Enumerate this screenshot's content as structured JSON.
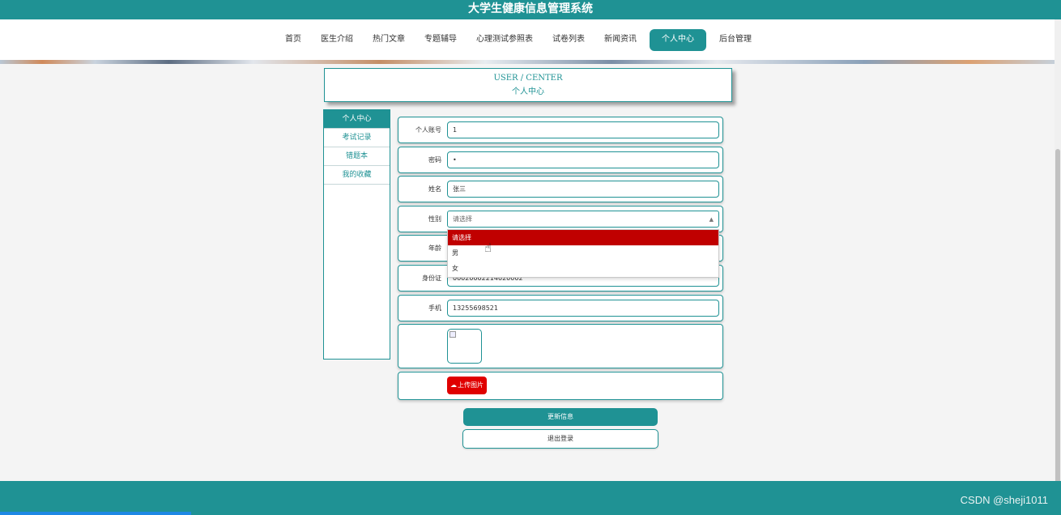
{
  "app": {
    "title": "大学生健康信息管理系统"
  },
  "nav": {
    "items": [
      {
        "label": "首页"
      },
      {
        "label": "医生介绍"
      },
      {
        "label": "热门文章"
      },
      {
        "label": "专题辅导"
      },
      {
        "label": "心理测试参照表"
      },
      {
        "label": "试卷列表"
      },
      {
        "label": "新闻资讯"
      },
      {
        "label": "个人中心",
        "active": true
      },
      {
        "label": "后台管理"
      }
    ]
  },
  "center_header": {
    "en": "USER / CENTER",
    "cn": "个人中心"
  },
  "sidebar": {
    "items": [
      {
        "label": "个人中心",
        "active": true
      },
      {
        "label": "考试记录"
      },
      {
        "label": "错题本"
      },
      {
        "label": "我的收藏"
      }
    ]
  },
  "form": {
    "account": {
      "label": "个人账号",
      "value": "1"
    },
    "password": {
      "label": "密码",
      "value": "•"
    },
    "name": {
      "label": "姓名",
      "value": "张三"
    },
    "gender": {
      "label": "性别",
      "placeholder": "请选择",
      "options": [
        "请选择",
        "男",
        "女"
      ],
      "highlighted": "请选择"
    },
    "age": {
      "label": "年龄"
    },
    "id_card": {
      "label": "身份证",
      "value": "00020002214020002"
    },
    "phone": {
      "label": "手机",
      "value": "13255698521"
    },
    "upload_label": "上传图片"
  },
  "buttons": {
    "update": "更新信息",
    "logout": "退出登录"
  },
  "watermark": "CSDN @sheji1011",
  "colors": {
    "primary": "#1f9294",
    "danger": "#e00000",
    "highlight": "#c00000"
  }
}
